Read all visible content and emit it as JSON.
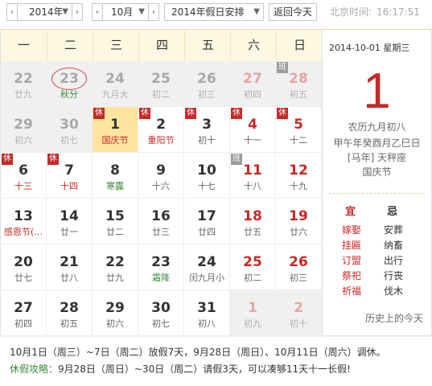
{
  "toolbar": {
    "year_value": "2014年",
    "month_value": "10月",
    "holiday_value": "2014年假日安排",
    "today_button": "返回今天",
    "prev_label": "‹",
    "next_label": "›",
    "clock_label": "北京时间:",
    "clock_time": "16:17:51"
  },
  "weekdays": [
    "一",
    "二",
    "三",
    "四",
    "五",
    "六",
    "日"
  ],
  "weeks": [
    [
      {
        "day": "22",
        "sub": "廿九",
        "other": true
      },
      {
        "day": "23",
        "sub": "秋分",
        "other": true,
        "sub_type": "term",
        "today_ring": true
      },
      {
        "day": "24",
        "sub": "九月大",
        "other": true
      },
      {
        "day": "25",
        "sub": "初二",
        "other": true
      },
      {
        "day": "26",
        "sub": "初三",
        "other": true
      },
      {
        "day": "27",
        "sub": "初四",
        "other": true,
        "weekend": true
      },
      {
        "day": "28",
        "sub": "初五",
        "other": true,
        "weekend": true,
        "badge": "班"
      }
    ],
    [
      {
        "day": "29",
        "sub": "初六",
        "other": true
      },
      {
        "day": "30",
        "sub": "初七",
        "other": true
      },
      {
        "day": "1",
        "sub": "国庆节",
        "sub_type": "festival",
        "badge": "休",
        "selected": true
      },
      {
        "day": "2",
        "sub": "重阳节",
        "sub_type": "festival",
        "badge": "休"
      },
      {
        "day": "3",
        "sub": "初十",
        "badge": "休"
      },
      {
        "day": "4",
        "sub": "十一",
        "weekend": true,
        "badge": "休"
      },
      {
        "day": "5",
        "sub": "十二",
        "weekend": true,
        "badge": "休"
      }
    ],
    [
      {
        "day": "6",
        "sub": "十三",
        "badge": "休",
        "sub_type": "festival"
      },
      {
        "day": "7",
        "sub": "十四",
        "badge": "休",
        "sub_type": "festival"
      },
      {
        "day": "8",
        "sub": "寒露",
        "sub_type": "term"
      },
      {
        "day": "9",
        "sub": "十六"
      },
      {
        "day": "10",
        "sub": "十七"
      },
      {
        "day": "11",
        "sub": "十八",
        "weekend": true,
        "badge": "班"
      },
      {
        "day": "12",
        "sub": "十九",
        "weekend": true
      }
    ],
    [
      {
        "day": "13",
        "sub": "感恩节(…",
        "sub_type": "festival"
      },
      {
        "day": "14",
        "sub": "廿一"
      },
      {
        "day": "15",
        "sub": "廿二"
      },
      {
        "day": "16",
        "sub": "廿三"
      },
      {
        "day": "17",
        "sub": "廿四"
      },
      {
        "day": "18",
        "sub": "廿五",
        "weekend": true
      },
      {
        "day": "19",
        "sub": "廿六",
        "weekend": true
      }
    ],
    [
      {
        "day": "20",
        "sub": "廿七"
      },
      {
        "day": "21",
        "sub": "廿八"
      },
      {
        "day": "22",
        "sub": "廿九"
      },
      {
        "day": "23",
        "sub": "霜降",
        "sub_type": "term"
      },
      {
        "day": "24",
        "sub": "闰九月小"
      },
      {
        "day": "25",
        "sub": "初二",
        "weekend": true
      },
      {
        "day": "26",
        "sub": "初三",
        "weekend": true
      }
    ],
    [
      {
        "day": "27",
        "sub": "初四"
      },
      {
        "day": "28",
        "sub": "初五"
      },
      {
        "day": "29",
        "sub": "初六"
      },
      {
        "day": "30",
        "sub": "初七"
      },
      {
        "day": "31",
        "sub": "初八"
      },
      {
        "day": "1",
        "sub": "初九",
        "other": true,
        "weekend": true
      },
      {
        "day": "2",
        "sub": "初十",
        "other": true,
        "weekend": true
      }
    ]
  ],
  "detail": {
    "date_line": "2014-10-01  星期三",
    "big_day": "1",
    "lunar_line": "农历九月初八",
    "ganzhi_line": "甲午年癸酉月乙巳日",
    "zodiac_line": "[马年] 天秤座",
    "festival_line": "国庆节",
    "yi_label": "宜",
    "ji_label": "忌",
    "yi_items": [
      "嫁娶",
      "挂匾",
      "订盟",
      "祭祀",
      "祈福"
    ],
    "ji_items": [
      "安葬",
      "纳畜",
      "出行",
      "行丧",
      "伐木"
    ],
    "history_link": "历史上的今天"
  },
  "notice": {
    "line1": "10月1日（周三）~7日（周二）放假7天，9月28日（周日）、10月11日（周六）调休。",
    "tip_label": "休假攻略：",
    "line2": "9月28日（周日）~30日（周二）请假3天，可以凑够11天十一长假!"
  },
  "colors": {
    "accent_red": "#c62828",
    "term_green": "#3a8a3a",
    "header_bg": "#fdf8e2",
    "selected_bg": "#ffe4a0"
  }
}
